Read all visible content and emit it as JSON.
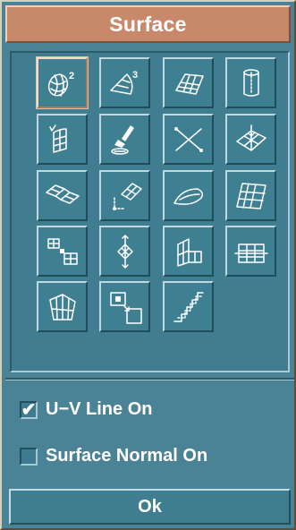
{
  "window": {
    "title": "Surface"
  },
  "tools": [
    {
      "id": "tool-1",
      "icon": "sphere-quadric-surface-icon",
      "superscript": "2",
      "selected": true
    },
    {
      "id": "tool-2",
      "icon": "cubic-curved-patch-icon",
      "superscript": "3",
      "selected": false
    },
    {
      "id": "tool-3",
      "icon": "grid-mesh-surface-icon",
      "selected": false
    },
    {
      "id": "tool-4",
      "icon": "cylinder-surface-icon",
      "selected": false
    },
    {
      "id": "tool-5",
      "icon": "sweep-along-curve-surface-icon",
      "selected": false
    },
    {
      "id": "tool-6",
      "icon": "sweep-brush-surface-icon",
      "selected": false
    },
    {
      "id": "tool-7",
      "icon": "intersect-curves-surface-icon",
      "selected": false
    },
    {
      "id": "tool-8",
      "icon": "point-on-mesh-surface-icon",
      "selected": false
    },
    {
      "id": "tool-9",
      "icon": "joined-patches-surface-icon",
      "selected": false
    },
    {
      "id": "tool-10",
      "icon": "offset-patch-surface-icon",
      "selected": false
    },
    {
      "id": "tool-11",
      "icon": "curved-leaf-surface-icon",
      "selected": false
    },
    {
      "id": "tool-12",
      "icon": "dense-grid-surface-icon",
      "selected": false
    },
    {
      "id": "tool-13",
      "icon": "grid-to-patch-surface-icon",
      "selected": false
    },
    {
      "id": "tool-14",
      "icon": "move-patch-surface-icon",
      "selected": false
    },
    {
      "id": "tool-15",
      "icon": "corner-planes-surface-icon",
      "selected": false
    },
    {
      "id": "tool-16",
      "icon": "trim-grid-surface-icon",
      "selected": false
    },
    {
      "id": "tool-17",
      "icon": "fan-grid-surface-icon",
      "selected": false
    },
    {
      "id": "tool-18",
      "icon": "copy-offset-square-icon",
      "selected": false
    },
    {
      "id": "tool-19",
      "icon": "staircase-surface-icon",
      "selected": false
    }
  ],
  "options": {
    "uv_line": {
      "label": "U−V Line On",
      "checked": true
    },
    "surface_normal": {
      "label": "Surface Normal On",
      "checked": false
    }
  },
  "buttons": {
    "ok_label": "Ok"
  },
  "colors": {
    "window_bg": "#4a8395",
    "title_bg": "#c8896a",
    "panel_bg": "#407d90",
    "button_bg": "#3f7f92",
    "text": "#ffffff"
  }
}
